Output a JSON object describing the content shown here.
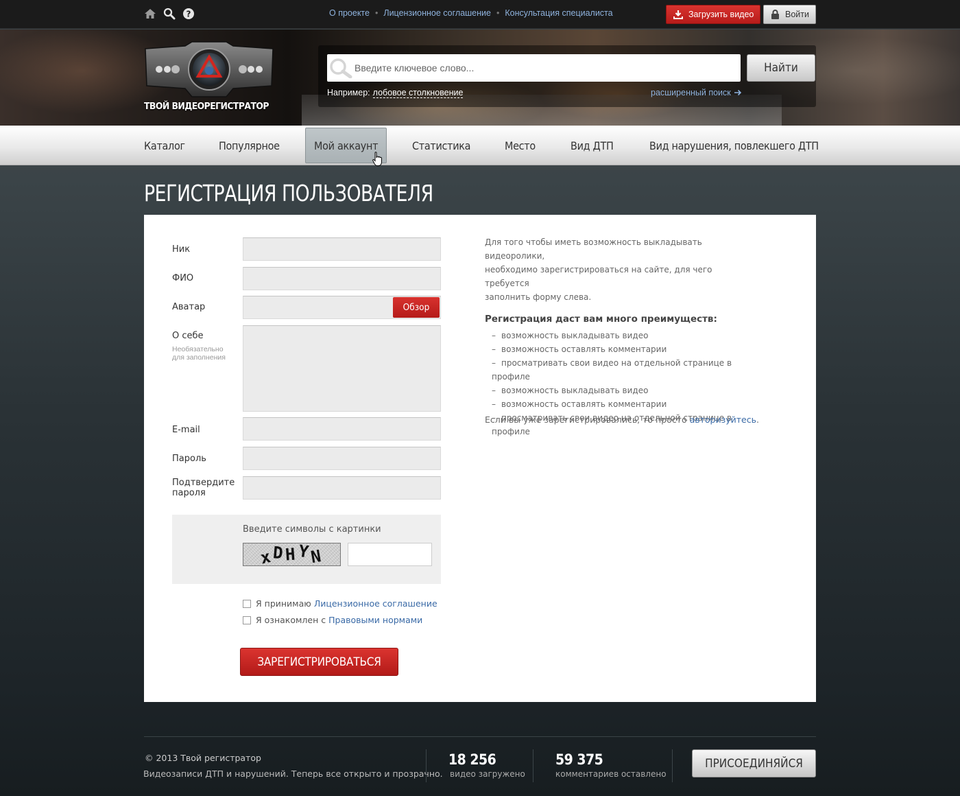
{
  "topbar": {
    "links": [
      "О проекте",
      "Лицензионное соглашение",
      "Консультация специалиста"
    ],
    "upload_label": "Загрузить видео",
    "login_label": "Войти",
    "icons": [
      "home-icon",
      "search-icon",
      "help-icon"
    ]
  },
  "header": {
    "logo_text": "ТВОЙ ВИДЕОРЕГИСТРАТОР",
    "search_placeholder": "Введите ключевое слово...",
    "find_label": "Найти",
    "example_label": "Например:",
    "example_link": "лобовое столкновение",
    "advanced_search": "расширенный поиск"
  },
  "nav": {
    "items": [
      "Каталог",
      "Популярное",
      "Мой аккаунт",
      "Статистика",
      "Место",
      "Вид ДТП",
      "Вид нарушения, повлекшего ДТП"
    ],
    "active_index": 2
  },
  "page": {
    "title": "РЕГИСТРАЦИЯ ПОЛЬЗОВАТЕЛЯ"
  },
  "form": {
    "nick_label": "Ник",
    "fio_label": "ФИО",
    "avatar_label": "Аватар",
    "browse_label": "Обзор",
    "about_label": "О себе",
    "about_hint_1": "Необязательно",
    "about_hint_2": "для заполнения",
    "email_label": "E-mail",
    "password_label": "Пароль",
    "confirm_label_1": "Подтвердите",
    "confirm_label_2": "пароля",
    "captcha_label": "Введите символы с картинки",
    "captcha_chars": [
      "x",
      "D",
      "H",
      "Y",
      "N"
    ],
    "accept_text": "Я принимаю",
    "accept_link": "Лицензионное соглашение",
    "rules_text": "Я ознакомлен с",
    "rules_link": "Правовыми нормами",
    "register_label": "ЗАРЕГИСТРИРОВАТЬСЯ"
  },
  "info": {
    "intro_1": "Для того чтобы иметь возможность выкладывать видеоролики,",
    "intro_2": "необходимо зарегистрироваться на сайте, для чего требуется",
    "intro_3": "заполнить форму слева.",
    "subtitle": "Регистрация даст вам много преимуществ:",
    "benefits": [
      "возможность выкладывать видео",
      "возможность оставлять комментарии",
      "просматривать свои видео на отдельной странице в профиле",
      "возможность выкладывать видео",
      "возможность оставлять комментарии",
      "просматривать свои видео на отдельной странице в профиле"
    ],
    "login_text": "Если вы уже зарегистрировались, то просто",
    "login_link": "авторизуйтесь"
  },
  "footer": {
    "copyright": "©  2013  Твой регистратор",
    "tagline": "Видеозаписи ДТП и нарушений. Теперь все открыто и прозрачно.",
    "videos_count": "18 256",
    "videos_label": "видео загружено",
    "comments_count": "59 375",
    "comments_label": "комментариев оставлено",
    "join_label": "ПРИСОЕДИНЯЙСЯ"
  },
  "colors": {
    "accent_red": "#c8221f",
    "link_blue": "#3a6aa6",
    "topbar_bg": "#1b1b1b"
  }
}
